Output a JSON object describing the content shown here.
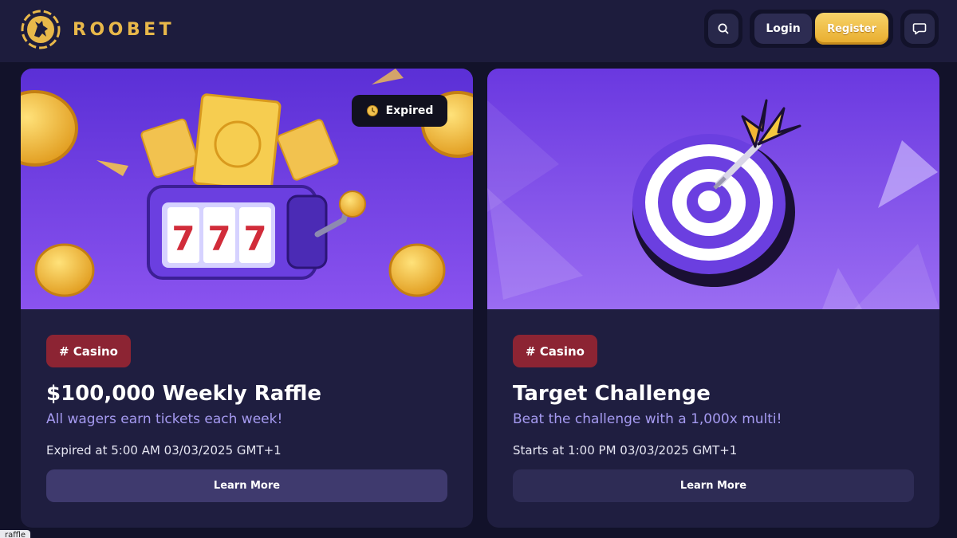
{
  "header": {
    "brand": "ROOBET",
    "login_label": "Login",
    "register_label": "Register",
    "icons": {
      "logo": "roobet-logo-icon",
      "search": "search-icon",
      "chat": "chat-icon"
    }
  },
  "promotions": [
    {
      "tag": "# Casino",
      "status_badge": "Expired",
      "title": "$100,000 Weekly Raffle",
      "subtitle": "All wagers earn tickets each week!",
      "date_text": "Expired at 5:00 AM 03/03/2025 GMT+1",
      "button_label": "Learn More",
      "slot_reels": "777"
    },
    {
      "tag": "# Casino",
      "title": "Target Challenge",
      "subtitle": "Beat the challenge with a 1,000x multi!",
      "date_text": "Starts at 1:00 PM 03/03/2025 GMT+1",
      "button_label": "Learn More"
    }
  ],
  "tooltip": "raffle",
  "colors": {
    "page_bg": "#12122a",
    "header_bg": "#1d1c3d",
    "card_bg": "#1f1e40",
    "brand_gold": "#e8b84a",
    "tag_red": "#8c2433",
    "subtitle_purple": "#a59af0",
    "register_gold": "#f2c24f"
  }
}
